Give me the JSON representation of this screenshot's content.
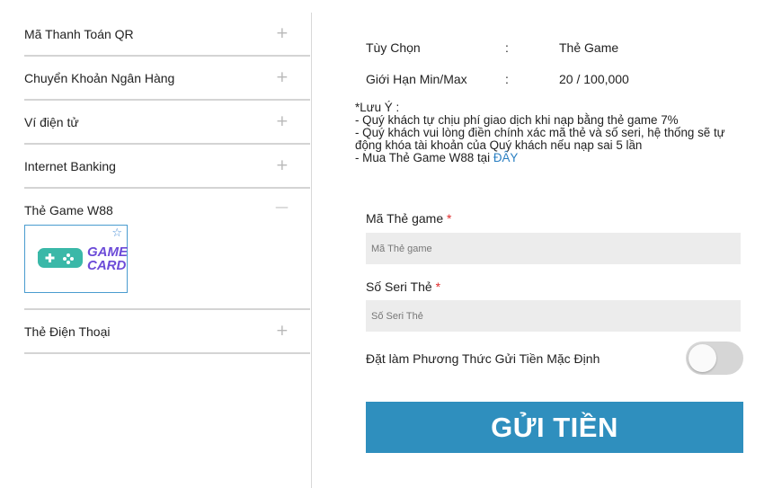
{
  "menu": {
    "items": [
      {
        "label": "Mã Thanh Toán QR",
        "toggle": "+"
      },
      {
        "label": "Chuyển Khoản Ngân Hàng",
        "toggle": "+"
      },
      {
        "label": "Ví điện tử",
        "toggle": "+"
      },
      {
        "label": "Internet Banking",
        "toggle": "+"
      },
      {
        "label": "Thẻ Game W88",
        "toggle": "—"
      },
      {
        "label": "Thẻ Điện Thoại",
        "toggle": "+"
      }
    ],
    "card_logo": {
      "line1": "GAME",
      "line2": "CARD",
      "star": "☆"
    }
  },
  "info": {
    "option_label": "Tùy Chọn",
    "option_colon": ":",
    "option_value": "Thẻ Game",
    "limit_label": "Giới Hạn Min/Max",
    "limit_colon": ":",
    "limit_value": "20 / 100,000"
  },
  "note": {
    "title": "*Lưu Ý :",
    "line1": "- Quý khách tự chịu phí giao dịch khi nạp bằng thẻ game 7%",
    "line2": "- Quý khách vui lòng điền chính xác mã thẻ và số seri, hệ thống sẽ tự động khóa tài khoản của Quý khách nếu nạp sai 5 lần",
    "line3_prefix": "- Mua Thẻ Game W88 tại ",
    "line3_link": "ĐÂY"
  },
  "form": {
    "card_code_label": "Mã Thẻ game",
    "card_code_placeholder": "Mã Thẻ game",
    "serial_label": "Số Seri Thẻ",
    "serial_placeholder": "Số Seri Thẻ",
    "required_mark": "*",
    "default_label": "Đặt làm Phương Thức Gửi Tiền Mặc Định",
    "default_on": false,
    "submit_label": "GỬI TIỀN"
  },
  "colors": {
    "accent": "#2f8fbe",
    "link": "#2a7fc2",
    "required": "#e02b2b",
    "logo_teal": "#3ab8a8",
    "logo_purple": "#6c4bd8"
  }
}
